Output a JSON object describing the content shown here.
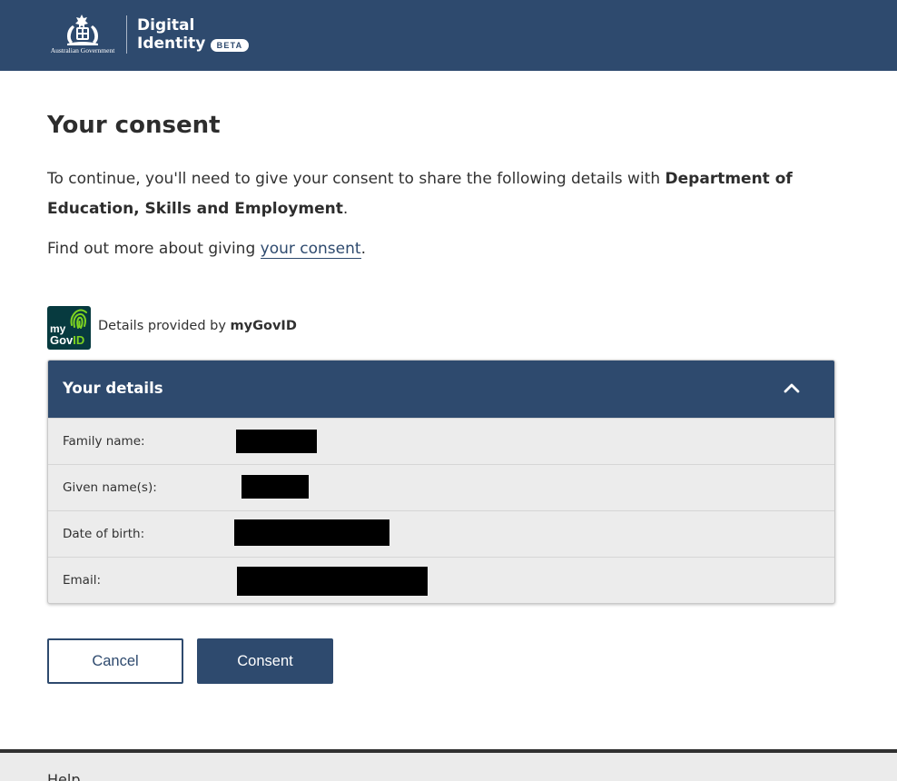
{
  "header": {
    "gov_name": "Australian Government",
    "title_line1": "Digital",
    "title_line2": "Identity",
    "badge": "BETA"
  },
  "page": {
    "title": "Your consent",
    "intro_text": "To continue, you'll need to give your consent to share the following details with ",
    "organisation": "Department of Education, Skills and Employment",
    "intro_end": ".",
    "more_prefix": "Find out more about giving ",
    "more_link": "your consent",
    "more_suffix": "."
  },
  "provider": {
    "logo_text_my": "my",
    "logo_text_gov": "Gov",
    "logo_text_id": "ID",
    "prefix": "Details provided by ",
    "name": "myGovID"
  },
  "details": {
    "title": "Your details",
    "toggle_icon": "chevron-up-icon",
    "rows": [
      {
        "label": "Family name:",
        "value": "[redacted]"
      },
      {
        "label": "Given name(s):",
        "value": "[redacted]"
      },
      {
        "label": "Date of birth:",
        "value": "[redacted]"
      },
      {
        "label": "Email:",
        "value": "[redacted]"
      }
    ]
  },
  "buttons": {
    "cancel": "Cancel",
    "consent": "Consent"
  },
  "footer": {
    "help": "Help"
  },
  "colors": {
    "brand_navy": "#2e4a6e",
    "mygovid_teal": "#073a3f",
    "mygovid_green": "#7ed321",
    "redaction": "#000000"
  }
}
